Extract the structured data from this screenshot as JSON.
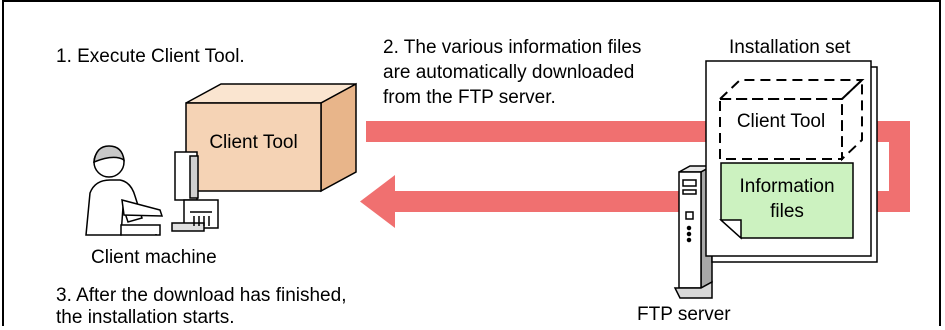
{
  "steps": {
    "step1": "1. Execute Client Tool.",
    "step2_lines": [
      "2. The various information files",
      "are automatically downloaded",
      "from the FTP server."
    ],
    "step3_lines": [
      "3. After the download has finished,",
      "the installation starts."
    ]
  },
  "labels": {
    "installation_set": "Installation set",
    "client_tool_box": "Client Tool",
    "client_tool_dashed": "Client Tool",
    "information_files_lines": [
      "Information",
      "files"
    ],
    "client_machine": "Client machine",
    "ftp_server": "FTP server"
  },
  "colors": {
    "arrow": "#f07070",
    "client_tool_box": "#f5d3b5",
    "information_files": "#ccf2c0"
  }
}
